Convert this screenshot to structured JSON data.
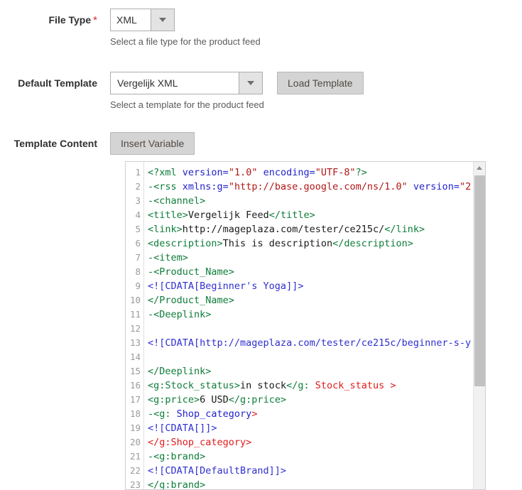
{
  "fields": {
    "file_type": {
      "label": "File Type",
      "required_marker": "*",
      "value": "XML",
      "hint": "Select a file type for the product feed",
      "dropdown_icon": "chevron-down-icon"
    },
    "default_template": {
      "label": "Default Template",
      "value": "Vergelijk XML",
      "hint": "Select a template for the product feed",
      "dropdown_icon": "chevron-down-icon",
      "load_button": "Load Template"
    },
    "template_content": {
      "label": "Template Content",
      "insert_variable_button": "Insert Variable"
    }
  },
  "editor": {
    "scroll_up_icon": "triangle-up-icon",
    "line_numbers": [
      1,
      2,
      3,
      4,
      5,
      6,
      7,
      8,
      9,
      10,
      11,
      12,
      13,
      14,
      15,
      16,
      17,
      18,
      19,
      20,
      21,
      22,
      23
    ],
    "lines": [
      {
        "n": 1,
        "tokens": [
          {
            "t": "<?xml ",
            "c": "tok-tag"
          },
          {
            "t": "version=",
            "c": "tok-attr"
          },
          {
            "t": "\"1.0\"",
            "c": "tok-str"
          },
          {
            "t": " ",
            "c": "tok-txt"
          },
          {
            "t": "encoding=",
            "c": "tok-attr"
          },
          {
            "t": "\"UTF-8\"",
            "c": "tok-str"
          },
          {
            "t": "?>",
            "c": "tok-tag"
          }
        ]
      },
      {
        "n": 2,
        "tokens": [
          {
            "t": "-<rss ",
            "c": "tok-tag"
          },
          {
            "t": "xmlns:g=",
            "c": "tok-attr"
          },
          {
            "t": "\"http://base.google.com/ns/1.0\"",
            "c": "tok-str"
          },
          {
            "t": " ",
            "c": "tok-txt"
          },
          {
            "t": "version=",
            "c": "tok-attr"
          },
          {
            "t": "\"2",
            "c": "tok-str"
          }
        ]
      },
      {
        "n": 3,
        "tokens": [
          {
            "t": "-<channel>",
            "c": "tok-tag"
          }
        ]
      },
      {
        "n": 4,
        "tokens": [
          {
            "t": "<title>",
            "c": "tok-tag"
          },
          {
            "t": "Vergelijk Feed",
            "c": "tok-txt"
          },
          {
            "t": "</title>",
            "c": "tok-tag"
          }
        ]
      },
      {
        "n": 5,
        "tokens": [
          {
            "t": "<link>",
            "c": "tok-tag"
          },
          {
            "t": "http://mageplaza.com/tester/ce215c/",
            "c": "tok-txt"
          },
          {
            "t": "</link>",
            "c": "tok-tag"
          }
        ]
      },
      {
        "n": 6,
        "tokens": [
          {
            "t": "<description>",
            "c": "tok-tag"
          },
          {
            "t": "This is description",
            "c": "tok-txt"
          },
          {
            "t": "</description>",
            "c": "tok-tag"
          }
        ]
      },
      {
        "n": 7,
        "tokens": [
          {
            "t": "-<item>",
            "c": "tok-tag"
          }
        ]
      },
      {
        "n": 8,
        "tokens": [
          {
            "t": "-<Product_Name>",
            "c": "tok-tag"
          }
        ]
      },
      {
        "n": 9,
        "tokens": [
          {
            "t": "<![CDATA[Beginner's Yoga]]>",
            "c": "tok-cdata"
          }
        ]
      },
      {
        "n": 10,
        "tokens": [
          {
            "t": "</Product_Name>",
            "c": "tok-tag"
          }
        ]
      },
      {
        "n": 11,
        "tokens": [
          {
            "t": "-<Deeplink>",
            "c": "tok-tag"
          }
        ]
      },
      {
        "n": 12,
        "tokens": []
      },
      {
        "n": 13,
        "tokens": [
          {
            "t": "<![CDATA[http://mageplaza.com/tester/ce215c/beginner-s-y",
            "c": "tok-cdata"
          }
        ]
      },
      {
        "n": 14,
        "tokens": []
      },
      {
        "n": 15,
        "tokens": [
          {
            "t": "</Deeplink>",
            "c": "tok-tag"
          }
        ]
      },
      {
        "n": 16,
        "tokens": [
          {
            "t": "<g:Stock_status>",
            "c": "tok-tag"
          },
          {
            "t": "in stock",
            "c": "tok-txt"
          },
          {
            "t": "</g:",
            "c": "tok-tag"
          },
          {
            "t": " Stock_status ",
            "c": "tok-tagred"
          },
          {
            "t": ">",
            "c": "tok-tagred"
          }
        ]
      },
      {
        "n": 17,
        "tokens": [
          {
            "t": "<g:price>",
            "c": "tok-tag"
          },
          {
            "t": "6 USD",
            "c": "tok-txt"
          },
          {
            "t": "</g:price>",
            "c": "tok-tag"
          }
        ]
      },
      {
        "n": 18,
        "tokens": [
          {
            "t": "-<g:",
            "c": "tok-tag"
          },
          {
            "t": " Shop_category",
            "c": "tok-attr"
          },
          {
            "t": ">",
            "c": "tok-tagred"
          }
        ]
      },
      {
        "n": 19,
        "tokens": [
          {
            "t": "<![CDATA[]]>",
            "c": "tok-cdata"
          }
        ]
      },
      {
        "n": 20,
        "tokens": [
          {
            "t": "</g:Shop_category>",
            "c": "tok-tagred"
          }
        ]
      },
      {
        "n": 21,
        "tokens": [
          {
            "t": "-<g:brand>",
            "c": "tok-tag"
          }
        ]
      },
      {
        "n": 22,
        "tokens": [
          {
            "t": "<![CDATA[DefaultBrand]]>",
            "c": "tok-cdata"
          }
        ]
      },
      {
        "n": 23,
        "tokens": [
          {
            "t": "</g:brand>",
            "c": "tok-tag"
          }
        ]
      }
    ]
  },
  "colors": {
    "required": "#e22626",
    "tag": "#0e7c3a",
    "tag_error": "#e01b1b",
    "attribute": "#2222cc",
    "string": "#b11717",
    "cdata": "#2f2fd0",
    "button_face": "#d4d4d4"
  }
}
